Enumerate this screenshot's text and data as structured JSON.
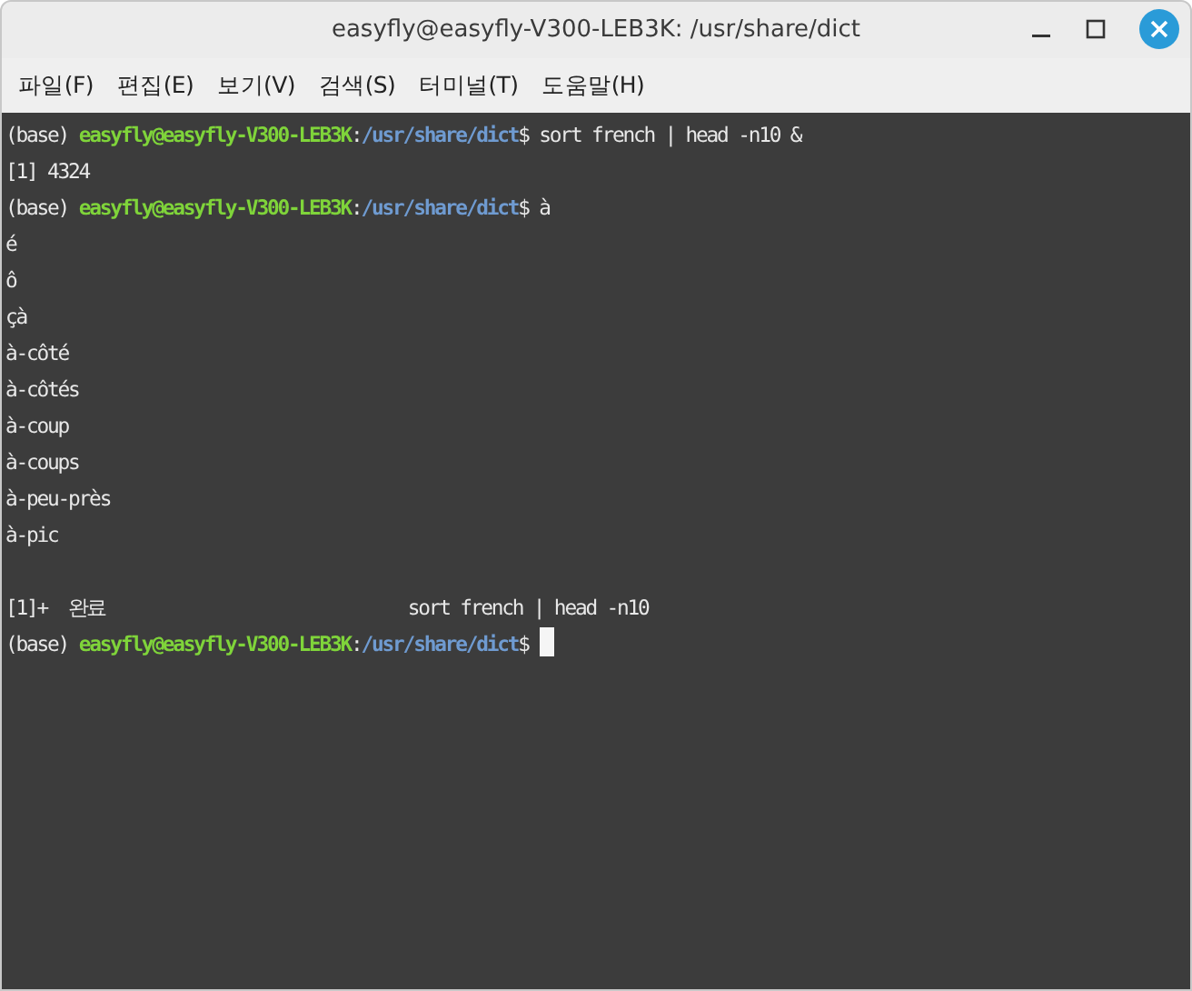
{
  "window": {
    "title": "easyfly@easyfly-V300-LEB3K: /usr/share/dict"
  },
  "menu": [
    "파일(F)",
    "편집(E)",
    "보기(V)",
    "검색(S)",
    "터미널(T)",
    "도움말(H)"
  ],
  "terminal": {
    "lines": [
      {
        "kind": "text",
        "segments": [
          {
            "kind": "plain",
            "text": "(base) "
          },
          {
            "kind": "user",
            "text": "easyfly@easyfly-V300-LEB3K"
          },
          {
            "kind": "plain",
            "text": ":"
          },
          {
            "kind": "path",
            "text": "/usr/share/dict"
          },
          {
            "kind": "plain",
            "text": "$ sort french | head -n10 &"
          }
        ]
      },
      {
        "kind": "text",
        "segments": [
          {
            "kind": "plain",
            "text": "[1] 4324"
          }
        ]
      },
      {
        "kind": "text",
        "segments": [
          {
            "kind": "plain",
            "text": "(base) "
          },
          {
            "kind": "user",
            "text": "easyfly@easyfly-V300-LEB3K"
          },
          {
            "kind": "plain",
            "text": ":"
          },
          {
            "kind": "path",
            "text": "/usr/share/dict"
          },
          {
            "kind": "plain",
            "text": "$ à"
          }
        ]
      },
      {
        "kind": "text",
        "segments": [
          {
            "kind": "plain",
            "text": "é"
          }
        ]
      },
      {
        "kind": "text",
        "segments": [
          {
            "kind": "plain",
            "text": "ô"
          }
        ]
      },
      {
        "kind": "text",
        "segments": [
          {
            "kind": "plain",
            "text": "çà"
          }
        ]
      },
      {
        "kind": "text",
        "segments": [
          {
            "kind": "plain",
            "text": "à-côté"
          }
        ]
      },
      {
        "kind": "text",
        "segments": [
          {
            "kind": "plain",
            "text": "à-côtés"
          }
        ]
      },
      {
        "kind": "text",
        "segments": [
          {
            "kind": "plain",
            "text": "à-coup"
          }
        ]
      },
      {
        "kind": "text",
        "segments": [
          {
            "kind": "plain",
            "text": "à-coups"
          }
        ]
      },
      {
        "kind": "text",
        "segments": [
          {
            "kind": "plain",
            "text": "à-peu-près"
          }
        ]
      },
      {
        "kind": "text",
        "segments": [
          {
            "kind": "plain",
            "text": "à-pic"
          }
        ]
      },
      {
        "kind": "blank"
      },
      {
        "kind": "text",
        "segments": [
          {
            "kind": "plain",
            "text": "[1]+  완료                             sort french | head -n10"
          }
        ]
      },
      {
        "kind": "text",
        "segments": [
          {
            "kind": "plain",
            "text": "(base) "
          },
          {
            "kind": "user",
            "text": "easyfly@easyfly-V300-LEB3K"
          },
          {
            "kind": "plain",
            "text": ":"
          },
          {
            "kind": "path",
            "text": "/usr/share/dict"
          },
          {
            "kind": "plain",
            "text": "$ "
          },
          {
            "kind": "cursor"
          }
        ]
      }
    ]
  }
}
